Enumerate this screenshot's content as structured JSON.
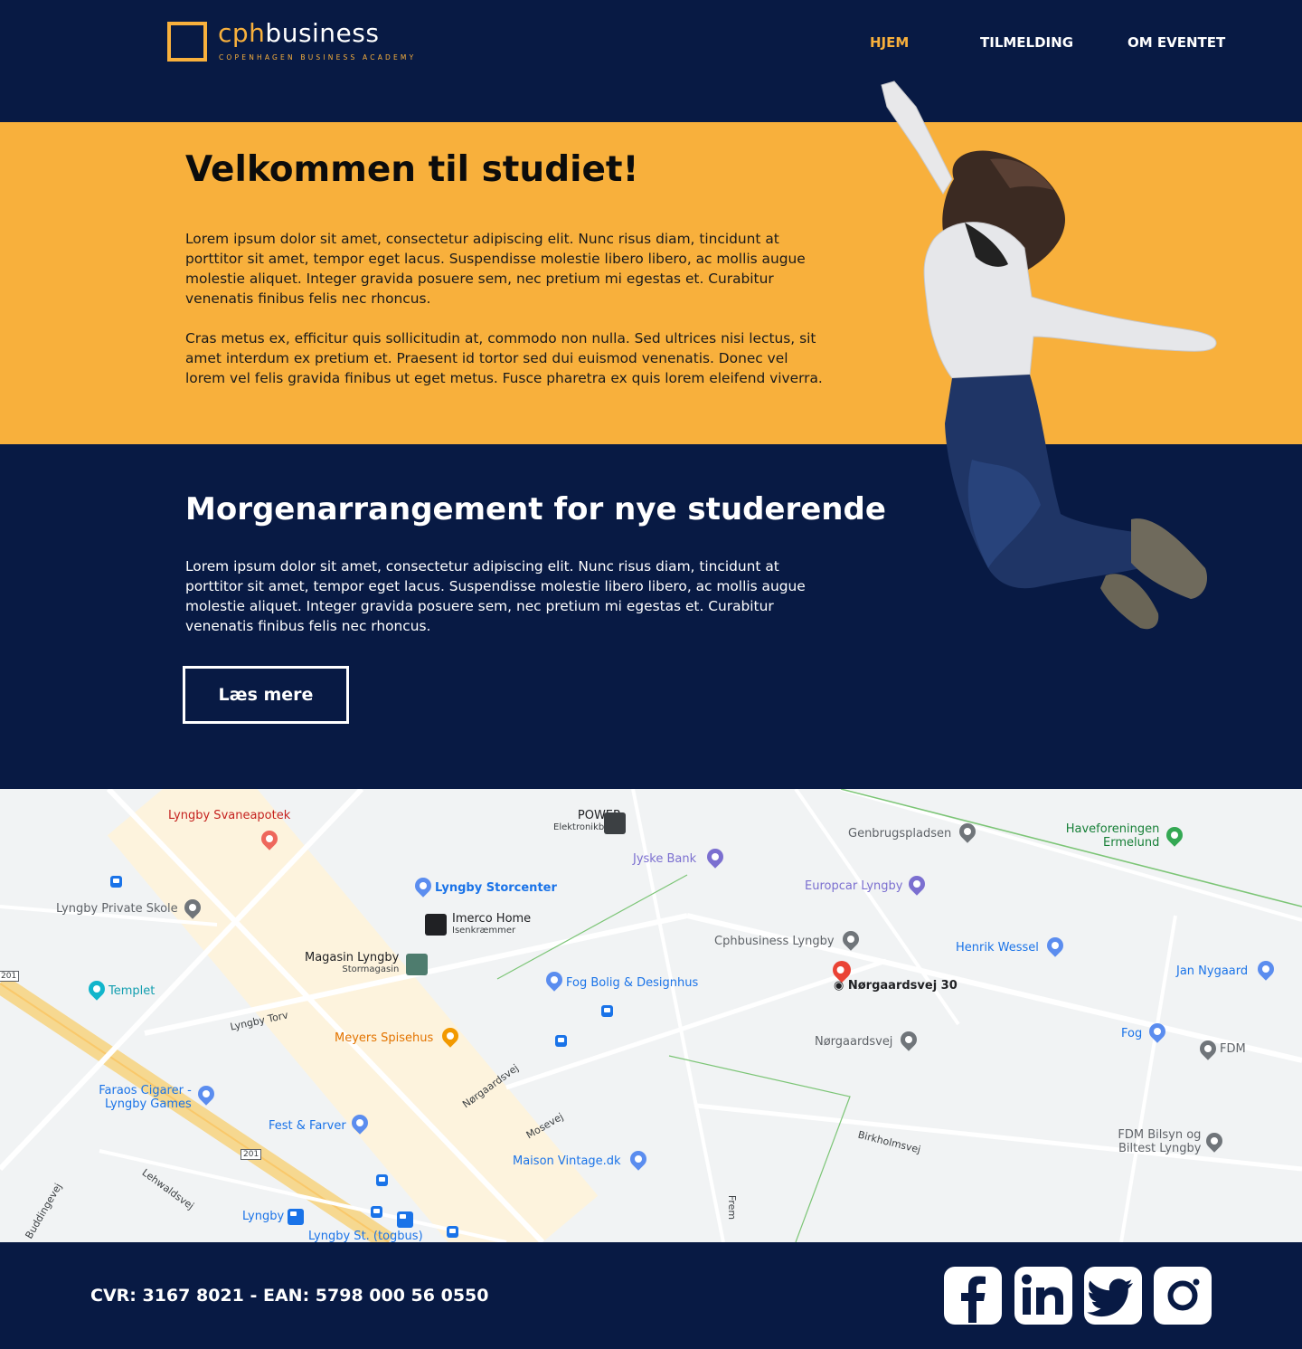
{
  "brand": {
    "name_prefix": "cph",
    "name_suffix": "business",
    "tagline": "COPENHAGEN BUSINESS ACADEMY",
    "accent_color": "#f8b03c",
    "navy_color": "#081a44"
  },
  "nav": {
    "items": [
      {
        "label": "HJEM",
        "active": true
      },
      {
        "label": "TILMELDING",
        "active": false
      },
      {
        "label": "OM EVENTET",
        "active": false
      }
    ]
  },
  "welcome": {
    "title": "Velkommen til studiet!",
    "paragraph1": "Lorem ipsum dolor sit amet, consectetur adipiscing elit. Nunc risus diam, tincidunt at porttitor sit amet, tempor eget lacus. Suspendisse molestie libero libero, ac mollis augue molestie aliquet. Integer gravida posuere sem, nec pretium mi egestas et. Curabitur venenatis finibus felis nec rhoncus.",
    "paragraph2": "Cras metus ex, efficitur quis sollicitudin at, commodo non nulla. Sed ultrices nisi lectus, sit amet interdum ex pretium et. Praesent id tortor sed dui euismod venenatis. Donec vel lorem vel felis gravida finibus ut eget metus. Fusce pharetra ex quis lorem eleifend viverra."
  },
  "event": {
    "title": "Morgenarrangement for nye studerende",
    "paragraph": "Lorem ipsum dolor sit amet, consectetur adipiscing elit. Nunc risus diam, tincidunt at porttitor sit amet, tempor eget lacus. Suspendisse molestie libero libero, ac mollis augue molestie aliquet. Integer gravida posuere sem, nec pretium mi egestas et. Curabitur venenatis finibus felis nec rhoncus.",
    "button_label": "Læs mere"
  },
  "map": {
    "places": {
      "svaneapotek": "Lyngby Svaneapotek",
      "power": "POWER",
      "power_sub": "Elektronikbutik",
      "jyske": "Jyske Bank",
      "genbrug": "Genbrugspladsen",
      "haveforeningen1": "Haveforeningen",
      "haveforeningen2": "Ermelund",
      "privatskole": "Lyngby Private Skole",
      "storcenter": "Lyngby Storcenter",
      "europcar": "Europcar Lyngby",
      "imerco": "Imerco Home",
      "imerco_sub": "Isenkræmmer",
      "cphbusiness": "Cphbusiness Lyngby",
      "henrik": "Henrik Wessel",
      "jan": "Jan Nygaard",
      "magasin": "Magasin Lyngby",
      "magasin_sub": "Stormagasin",
      "fog_bolig": "Fog Bolig & Designhus",
      "target": "Nørgaardsvej 30",
      "templet": "Templet",
      "meyers": "Meyers Spisehus",
      "norgaardsvej_place": "Nørgaardsvej",
      "fog": "Fog",
      "fdm": "FDM",
      "faraos1": "Faraos Cigarer -",
      "faraos2": "Lyngby Games",
      "fest": "Fest & Farver",
      "maison": "Maison Vintage.dk",
      "fdm_bilsyn1": "FDM Bilsyn og",
      "fdm_bilsyn2": "Biltest Lyngby",
      "lyngby": "Lyngby",
      "lyngby_st": "Lyngby St. (togbus)"
    },
    "roads": {
      "lyngby_torv": "Lyngby Torv",
      "norgaardsvej": "Nørgaardsvej",
      "mosevej": "Mosevej",
      "birkholmsvej": "Birkholmsvej",
      "lehwaldsvej": "Lehwaldsvej",
      "buddingevej": "Buddingevej",
      "frem": "Frem",
      "route201a": "201",
      "route201b": "201"
    }
  },
  "footer": {
    "company_info": "CVR: 3167 8021 - EAN: 5798 000 56 0550",
    "social": [
      "facebook-icon",
      "linkedin-icon",
      "twitter-icon",
      "instagram-icon"
    ]
  }
}
